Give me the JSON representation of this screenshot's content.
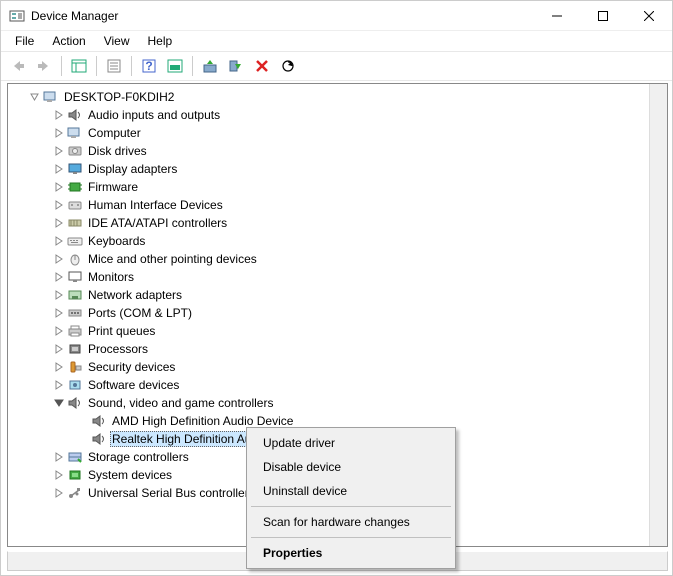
{
  "window": {
    "title": "Device Manager"
  },
  "menu": {
    "file": "File",
    "action": "Action",
    "view": "View",
    "help": "Help"
  },
  "root": {
    "name": "DESKTOP-F0KDIH2"
  },
  "nodes": [
    {
      "label": "Audio inputs and outputs",
      "icon": "speaker"
    },
    {
      "label": "Computer",
      "icon": "computer"
    },
    {
      "label": "Disk drives",
      "icon": "disk"
    },
    {
      "label": "Display adapters",
      "icon": "display"
    },
    {
      "label": "Firmware",
      "icon": "chip"
    },
    {
      "label": "Human Interface Devices",
      "icon": "hid"
    },
    {
      "label": "IDE ATA/ATAPI controllers",
      "icon": "ide"
    },
    {
      "label": "Keyboards",
      "icon": "keyboard"
    },
    {
      "label": "Mice and other pointing devices",
      "icon": "mouse"
    },
    {
      "label": "Monitors",
      "icon": "monitor"
    },
    {
      "label": "Network adapters",
      "icon": "network"
    },
    {
      "label": "Ports (COM & LPT)",
      "icon": "port"
    },
    {
      "label": "Print queues",
      "icon": "printer"
    },
    {
      "label": "Processors",
      "icon": "cpu"
    },
    {
      "label": "Security devices",
      "icon": "security"
    },
    {
      "label": "Software devices",
      "icon": "software"
    }
  ],
  "expanded_node": {
    "label": "Sound, video and game controllers"
  },
  "sound_children": [
    {
      "label": "AMD High Definition Audio Device"
    },
    {
      "label": "Realtek High Definition Audio",
      "selected": true
    }
  ],
  "after_nodes": [
    {
      "label": "Storage controllers",
      "icon": "storage"
    },
    {
      "label": "System devices",
      "icon": "system"
    },
    {
      "label": "Universal Serial Bus controllers",
      "icon": "usb"
    }
  ],
  "context_menu": {
    "update": "Update driver",
    "disable": "Disable device",
    "uninstall": "Uninstall device",
    "scan": "Scan for hardware changes",
    "properties": "Properties"
  }
}
